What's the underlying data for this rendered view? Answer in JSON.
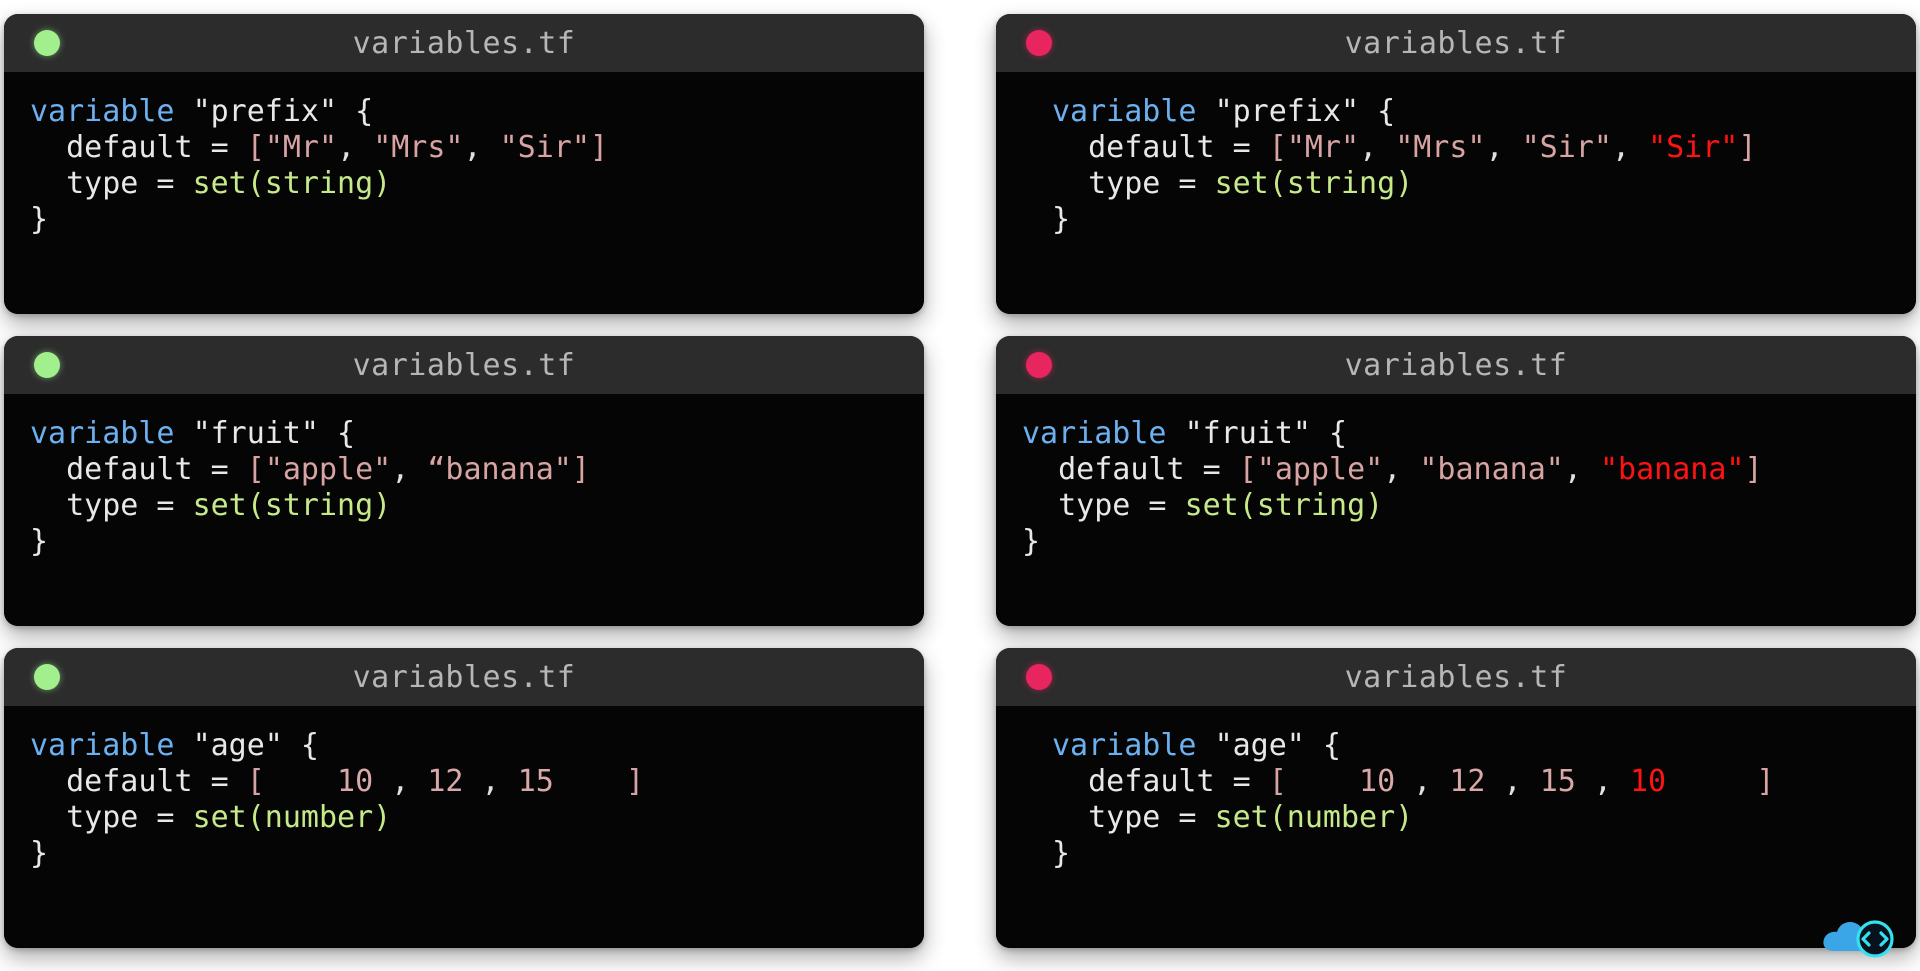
{
  "colors": {
    "page_background": "#ffffff",
    "card_header": "#2c2c2c",
    "card_body": "#050505",
    "dot_ok": "#a2ef8e",
    "dot_duplicate": "#e8255f",
    "keyword": "#6cb0f0",
    "string": "#d7a3a3",
    "function": "#c6e98a",
    "error": "#ff1212",
    "title_text": "#b6b6b6"
  },
  "watermark": {
    "icon": "cloud-code-icon",
    "cloud_color": "#3aa6e8",
    "ring_color": "#35e0f0"
  },
  "cards": [
    {
      "id": "prefix-valid",
      "status": "ok",
      "dot_icon": "green-status-dot-icon",
      "title": "variables.tf",
      "indented": false,
      "lines": [
        {
          "tokens": [
            {
              "text": "variable ",
              "class": "tok-kw"
            },
            {
              "text": "\"prefix\"",
              "class": "tok-plain"
            },
            {
              "text": " {",
              "class": "tok-plain"
            }
          ]
        },
        {
          "tokens": [
            {
              "text": "  default = ",
              "class": "tok-plain"
            },
            {
              "text": "[",
              "class": "tok-brk"
            },
            {
              "text": "\"Mr\"",
              "class": "tok-str"
            },
            {
              "text": ", ",
              "class": "tok-punc"
            },
            {
              "text": "\"Mrs\"",
              "class": "tok-str"
            },
            {
              "text": ", ",
              "class": "tok-punc"
            },
            {
              "text": "\"Sir\"",
              "class": "tok-str"
            },
            {
              "text": "]",
              "class": "tok-brk"
            }
          ]
        },
        {
          "tokens": [
            {
              "text": "  type = ",
              "class": "tok-plain"
            },
            {
              "text": "set(string)",
              "class": "tok-fn"
            }
          ]
        },
        {
          "tokens": [
            {
              "text": "}",
              "class": "tok-plain"
            }
          ]
        }
      ]
    },
    {
      "id": "prefix-duplicate",
      "status": "duplicate",
      "dot_icon": "pink-status-dot-icon",
      "title": "variables.tf",
      "indented": true,
      "lines": [
        {
          "tokens": [
            {
              "text": "variable ",
              "class": "tok-kw"
            },
            {
              "text": "\"prefix\"",
              "class": "tok-plain"
            },
            {
              "text": " {",
              "class": "tok-plain"
            }
          ]
        },
        {
          "tokens": [
            {
              "text": "  default = ",
              "class": "tok-plain"
            },
            {
              "text": "[",
              "class": "tok-brk"
            },
            {
              "text": "\"Mr\"",
              "class": "tok-str"
            },
            {
              "text": ", ",
              "class": "tok-punc"
            },
            {
              "text": "\"Mrs\"",
              "class": "tok-str"
            },
            {
              "text": ", ",
              "class": "tok-punc"
            },
            {
              "text": "\"Sir\"",
              "class": "tok-str"
            },
            {
              "text": ", ",
              "class": "tok-punc"
            },
            {
              "text": "\"Sir\"",
              "class": "tok-err"
            },
            {
              "text": "]",
              "class": "tok-brk"
            }
          ]
        },
        {
          "tokens": [
            {
              "text": "  type = ",
              "class": "tok-plain"
            },
            {
              "text": "set(string)",
              "class": "tok-fn"
            }
          ]
        },
        {
          "tokens": [
            {
              "text": "}",
              "class": "tok-plain"
            }
          ]
        }
      ]
    },
    {
      "id": "fruit-valid",
      "status": "ok",
      "dot_icon": "green-status-dot-icon",
      "title": "variables.tf",
      "indented": false,
      "lines": [
        {
          "tokens": [
            {
              "text": "variable ",
              "class": "tok-kw"
            },
            {
              "text": "\"fruit\"",
              "class": "tok-plain"
            },
            {
              "text": " {",
              "class": "tok-plain"
            }
          ]
        },
        {
          "tokens": [
            {
              "text": "  default = ",
              "class": "tok-plain"
            },
            {
              "text": "[",
              "class": "tok-brk"
            },
            {
              "text": "\"apple\"",
              "class": "tok-str"
            },
            {
              "text": ", ",
              "class": "tok-punc"
            },
            {
              "text": "“banana\"",
              "class": "tok-str"
            },
            {
              "text": "]",
              "class": "tok-brk"
            }
          ]
        },
        {
          "tokens": [
            {
              "text": "  type = ",
              "class": "tok-plain"
            },
            {
              "text": "set(string)",
              "class": "tok-fn"
            }
          ]
        },
        {
          "tokens": [
            {
              "text": "}",
              "class": "tok-plain"
            }
          ]
        }
      ]
    },
    {
      "id": "fruit-duplicate",
      "status": "duplicate",
      "dot_icon": "pink-status-dot-icon",
      "title": "variables.tf",
      "indented": false,
      "lines": [
        {
          "tokens": [
            {
              "text": "variable ",
              "class": "tok-kw"
            },
            {
              "text": "\"fruit\"",
              "class": "tok-plain"
            },
            {
              "text": " {",
              "class": "tok-plain"
            }
          ]
        },
        {
          "tokens": [
            {
              "text": "  default = ",
              "class": "tok-plain"
            },
            {
              "text": "[",
              "class": "tok-brk"
            },
            {
              "text": "\"apple\"",
              "class": "tok-str"
            },
            {
              "text": ", ",
              "class": "tok-punc"
            },
            {
              "text": "\"banana\"",
              "class": "tok-str"
            },
            {
              "text": ", ",
              "class": "tok-punc"
            },
            {
              "text": "\"banana\"",
              "class": "tok-err"
            },
            {
              "text": "]",
              "class": "tok-brk"
            }
          ]
        },
        {
          "tokens": [
            {
              "text": "  type = ",
              "class": "tok-plain"
            },
            {
              "text": "set(string)",
              "class": "tok-fn"
            }
          ]
        },
        {
          "tokens": [
            {
              "text": "}",
              "class": "tok-plain"
            }
          ]
        }
      ]
    },
    {
      "id": "age-valid",
      "status": "ok",
      "dot_icon": "green-status-dot-icon",
      "title": "variables.tf",
      "indented": false,
      "lines": [
        {
          "tokens": [
            {
              "text": "variable ",
              "class": "tok-kw"
            },
            {
              "text": "\"age\"",
              "class": "tok-plain"
            },
            {
              "text": " {",
              "class": "tok-plain"
            }
          ]
        },
        {
          "tokens": [
            {
              "text": "  default = ",
              "class": "tok-plain"
            },
            {
              "text": "[",
              "class": "tok-brk"
            },
            {
              "text": "    10",
              "class": "tok-num"
            },
            {
              "text": " , ",
              "class": "tok-punc"
            },
            {
              "text": "12",
              "class": "tok-num"
            },
            {
              "text": " , ",
              "class": "tok-punc"
            },
            {
              "text": "15",
              "class": "tok-num"
            },
            {
              "text": "    ]",
              "class": "tok-brk"
            }
          ]
        },
        {
          "tokens": [
            {
              "text": "  type = ",
              "class": "tok-plain"
            },
            {
              "text": "set(number)",
              "class": "tok-fn"
            }
          ]
        },
        {
          "tokens": [
            {
              "text": "}",
              "class": "tok-plain"
            }
          ]
        }
      ]
    },
    {
      "id": "age-duplicate",
      "status": "duplicate",
      "dot_icon": "pink-status-dot-icon",
      "title": "variables.tf",
      "indented": true,
      "lines": [
        {
          "tokens": [
            {
              "text": "variable ",
              "class": "tok-kw"
            },
            {
              "text": "\"age\"",
              "class": "tok-plain"
            },
            {
              "text": " {",
              "class": "tok-plain"
            }
          ]
        },
        {
          "tokens": [
            {
              "text": "  default = ",
              "class": "tok-plain"
            },
            {
              "text": "[",
              "class": "tok-brk"
            },
            {
              "text": "    10",
              "class": "tok-num"
            },
            {
              "text": " , ",
              "class": "tok-punc"
            },
            {
              "text": "12",
              "class": "tok-num"
            },
            {
              "text": " , ",
              "class": "tok-punc"
            },
            {
              "text": "15",
              "class": "tok-num"
            },
            {
              "text": " , ",
              "class": "tok-punc"
            },
            {
              "text": "10",
              "class": "tok-err"
            },
            {
              "text": "     ]",
              "class": "tok-brk"
            }
          ]
        },
        {
          "tokens": [
            {
              "text": "  type = ",
              "class": "tok-plain"
            },
            {
              "text": "set(number)",
              "class": "tok-fn"
            }
          ]
        },
        {
          "tokens": [
            {
              "text": "}",
              "class": "tok-plain"
            }
          ]
        }
      ]
    }
  ]
}
